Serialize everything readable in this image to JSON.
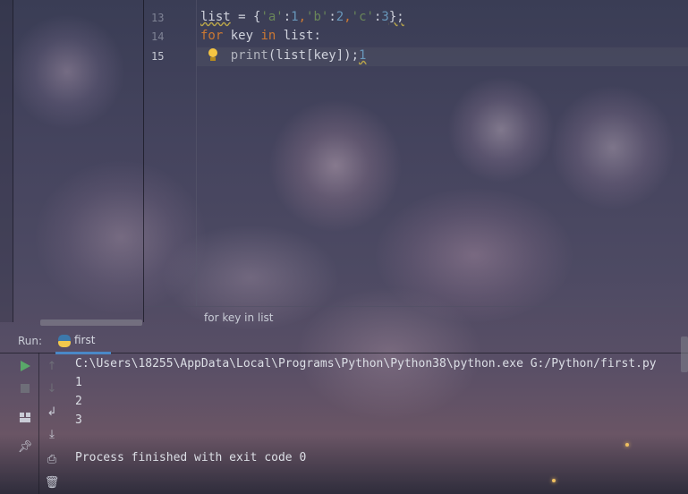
{
  "editor": {
    "line_numbers": [
      "13",
      "14",
      "15"
    ],
    "lines": [
      [
        {
          "t": "list",
          "c": "warn"
        },
        {
          "t": " = {",
          "c": ""
        },
        {
          "t": "'a'",
          "c": "str"
        },
        {
          "t": ":",
          "c": ""
        },
        {
          "t": "1",
          "c": "num"
        },
        {
          "t": ",",
          "c": "kw"
        },
        {
          "t": "'b'",
          "c": "str"
        },
        {
          "t": ":",
          "c": ""
        },
        {
          "t": "2",
          "c": "num"
        },
        {
          "t": ",",
          "c": "kw"
        },
        {
          "t": "'c'",
          "c": "str"
        },
        {
          "t": ":",
          "c": ""
        },
        {
          "t": "3",
          "c": "num"
        },
        {
          "t": "};",
          "c": "warn"
        }
      ],
      [
        {
          "t": "for",
          "c": "kw"
        },
        {
          "t": " key ",
          "c": ""
        },
        {
          "t": "in",
          "c": "kw"
        },
        {
          "t": " list:",
          "c": ""
        }
      ],
      [
        {
          "t": "    ",
          "c": ""
        },
        {
          "t": "print",
          "c": "fn"
        },
        {
          "t": "(list[key]);",
          "c": ""
        },
        {
          "t": "1",
          "c": "num warn"
        }
      ]
    ],
    "current_line_index": 2,
    "intention_icon": "lightbulb-icon"
  },
  "breadcrumb": {
    "text": "for key in list"
  },
  "run_panel": {
    "label": "Run:",
    "tab_label": "first",
    "tab_icon": "python-file-icon",
    "toolbar_left": [
      "run-icon",
      "stop-icon",
      "layout-icon",
      "pin-icon"
    ],
    "toolbar_right": [
      "rerun-icon",
      "down-icon",
      "soft-wrap-icon",
      "scroll-to-end-icon",
      "print-icon",
      "trash-icon"
    ],
    "console_lines": [
      "C:\\Users\\18255\\AppData\\Local\\Programs\\Python\\Python38\\python.exe G:/Python/first.py",
      "1",
      "2",
      "3",
      "",
      "Process finished with exit code 0"
    ]
  },
  "colors": {
    "keyword": "#cc7832",
    "string": "#6a8759",
    "number": "#6897bb",
    "run_green": "#59a869",
    "tab_underline": "#4a88c7"
  }
}
